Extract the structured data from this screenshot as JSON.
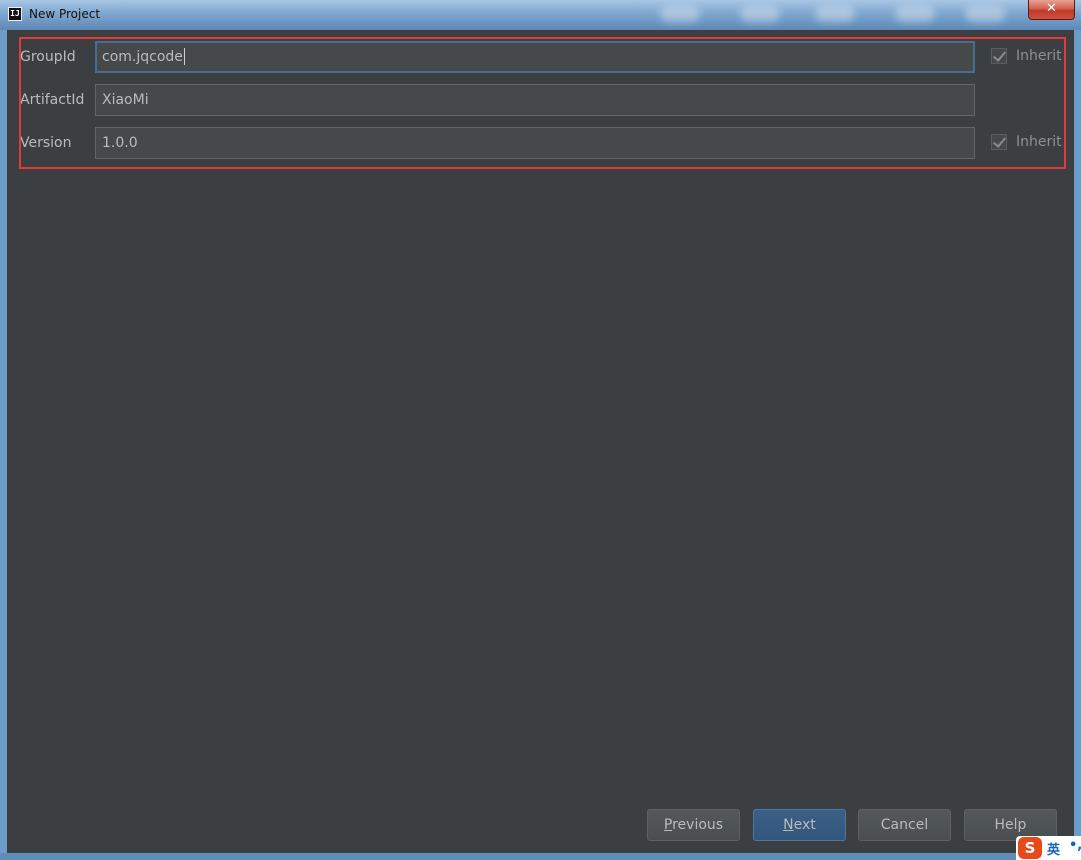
{
  "window": {
    "title": "New Project",
    "app_icon": "IJ",
    "close_glyph": "✕"
  },
  "form": {
    "group_id": {
      "label": "GroupId",
      "value": "com.jqcode",
      "inherit_label": "Inherit",
      "inherit_checked": true
    },
    "artifact_id": {
      "label": "ArtifactId",
      "value": "XiaoMi"
    },
    "version": {
      "label": "Version",
      "value": "1.0.0",
      "inherit_label": "Inherit",
      "inherit_checked": true
    }
  },
  "buttons": {
    "previous": {
      "mnemonic": "P",
      "rest": "revious"
    },
    "next": {
      "mnemonic": "N",
      "rest": "ext"
    },
    "cancel": "Cancel",
    "help": "Help"
  },
  "ime": {
    "logo": "S",
    "lang": "英",
    "punct": "•,"
  },
  "colors": {
    "background": "#3c3f41",
    "field": "#45494a",
    "focus_border": "#466d94",
    "highlight_box": "#e03a3a",
    "primary_button": "#365880"
  }
}
